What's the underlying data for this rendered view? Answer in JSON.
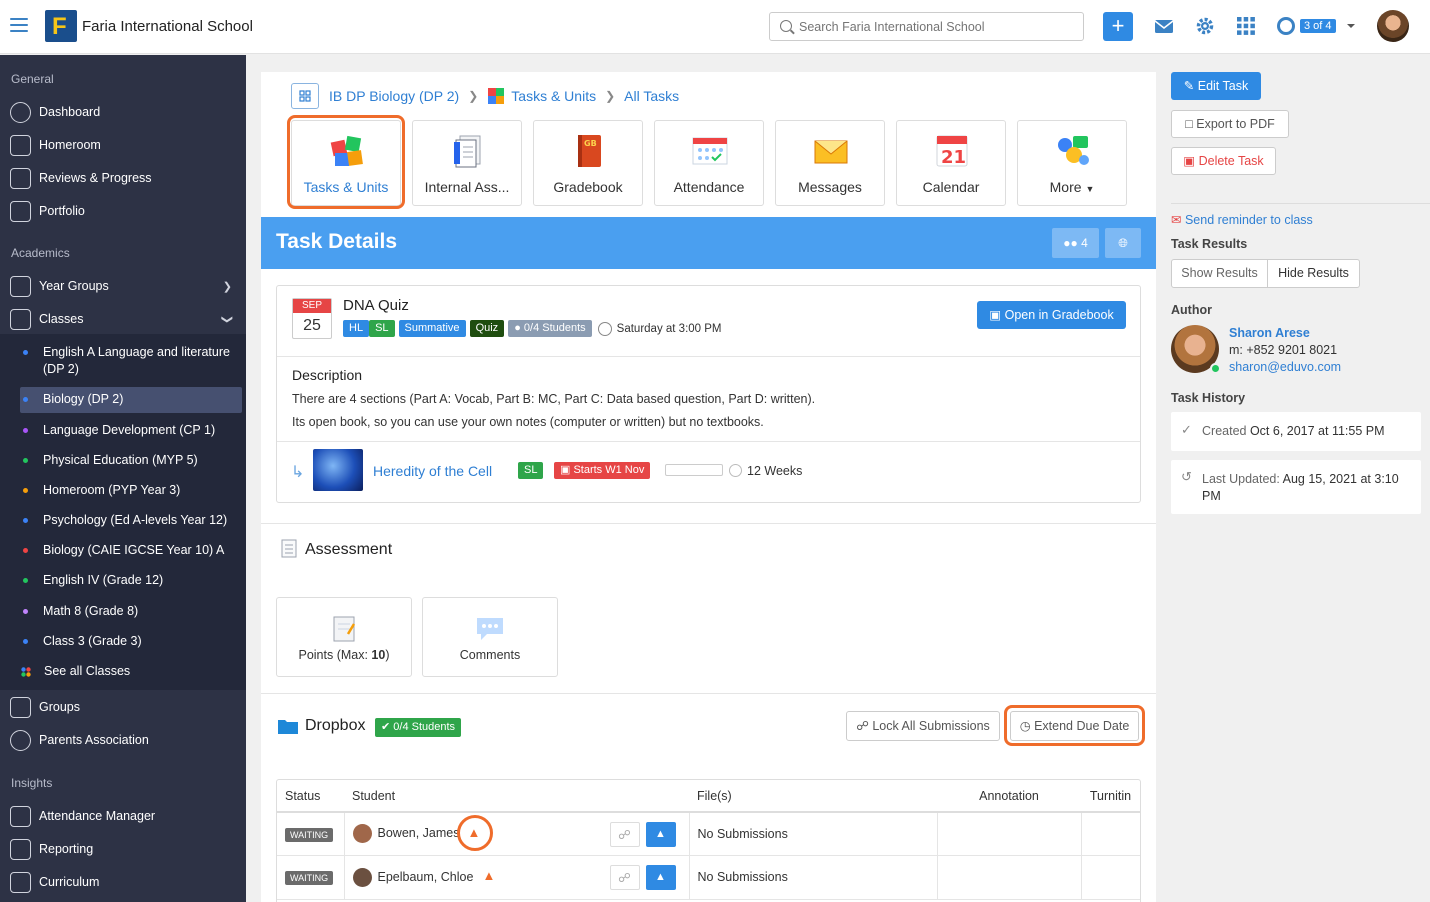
{
  "header": {
    "school_name": "Faria International School",
    "search_placeholder": "Search Faria International School",
    "pager": "3 of 4",
    "logo_letter": "F"
  },
  "sidebar": {
    "general_label": "General",
    "general": [
      {
        "label": "Dashboard"
      },
      {
        "label": "Homeroom"
      },
      {
        "label": "Reviews & Progress"
      },
      {
        "label": "Portfolio"
      }
    ],
    "academics_label": "Academics",
    "academics": [
      {
        "label": "Year Groups"
      },
      {
        "label": "Classes"
      }
    ],
    "classes": [
      {
        "label": "English A Language and literature (DP 2)",
        "color": "#3b82f6"
      },
      {
        "label": "Biology (DP 2)",
        "color": "#3b82f6"
      },
      {
        "label": "Language Development (CP 1)",
        "color": "#a855f7"
      },
      {
        "label": "Physical Education (MYP 5)",
        "color": "#22c55e"
      },
      {
        "label": "Homeroom (PYP Year 3)",
        "color": "#f59e0b"
      },
      {
        "label": "Psychology (Ed A-levels Year 12)",
        "color": "#3b82f6"
      },
      {
        "label": "Biology (CAIE IGCSE Year 10) A",
        "color": "#ef4444"
      },
      {
        "label": "English IV (Grade 12)",
        "color": "#22c55e"
      },
      {
        "label": "Math 8 (Grade 8)",
        "color": "#c084fc"
      },
      {
        "label": "Class 3 (Grade 3)",
        "color": "#3b82f6"
      },
      {
        "label": "See all Classes",
        "color": "multi"
      }
    ],
    "more": [
      {
        "label": "Groups"
      },
      {
        "label": "Parents Association"
      }
    ],
    "insights_label": "Insights",
    "insights": [
      {
        "label": "Attendance Manager"
      },
      {
        "label": "Reporting"
      },
      {
        "label": "Curriculum"
      }
    ]
  },
  "breadcrumb": [
    "IB DP Biology (DP 2)",
    "Tasks & Units",
    "All Tasks"
  ],
  "tiles": [
    {
      "label": "Tasks & Units"
    },
    {
      "label": "Internal Ass..."
    },
    {
      "label": "Gradebook"
    },
    {
      "label": "Attendance"
    },
    {
      "label": "Messages"
    },
    {
      "label": "Calendar"
    },
    {
      "label": "More"
    }
  ],
  "gradebook_tile_text": "GB",
  "calendar_tile_day": "21",
  "task": {
    "header": "Task Details",
    "group_count": "4",
    "month": "SEP",
    "day": "25",
    "title": "DNA Quiz",
    "tags": [
      "HL",
      "SL",
      "Summative",
      "Quiz"
    ],
    "students": "0/4 Students",
    "due": "Saturday at 3:00 PM",
    "open_gradebook": "Open in Gradebook",
    "description_label": "Description",
    "description_lines": [
      "There are 4 sections (Part A: Vocab, Part B: MC, Part C: Data based question, Part D: written).",
      "Its open book, so you can use your own notes (computer or written) but no textbooks."
    ],
    "unit": {
      "title": "Heredity of the Cell",
      "level": "SL",
      "starts": "Starts W1 Nov",
      "duration": "12 Weeks"
    }
  },
  "assessment": {
    "title": "Assessment",
    "points_prefix": "Points (Max: ",
    "points_max": "10",
    "points_suffix": ")",
    "comments": "Comments"
  },
  "dropbox": {
    "title": "Dropbox",
    "students": "0/4 Students",
    "lock": "Lock All Submissions",
    "extend": "Extend Due Date",
    "columns": [
      "Status",
      "Student",
      "File(s)",
      "Annotation",
      "Turnitin"
    ],
    "rows": [
      {
        "status": "WAITING",
        "name": "Bowen, James",
        "files": "No Submissions"
      },
      {
        "status": "WAITING",
        "name": "Epelbaum, Chloe",
        "files": "No Submissions"
      }
    ]
  },
  "right": {
    "edit": "Edit Task",
    "export": "Export to PDF",
    "delete": "Delete Task",
    "reminder": "Send reminder to class",
    "results_label": "Task Results",
    "show_results": "Show Results",
    "hide_results": "Hide Results",
    "author_label": "Author",
    "author_name": "Sharon Arese",
    "author_phone": "m: +852 9201 8021",
    "author_email": "sharon@eduvo.com",
    "history_label": "Task History",
    "created_prefix": "Created ",
    "created": "Oct 6, 2017 at 11:55 PM",
    "updated_prefix": "Last Updated: ",
    "updated": "Aug 15, 2021 at 3:10 PM"
  }
}
